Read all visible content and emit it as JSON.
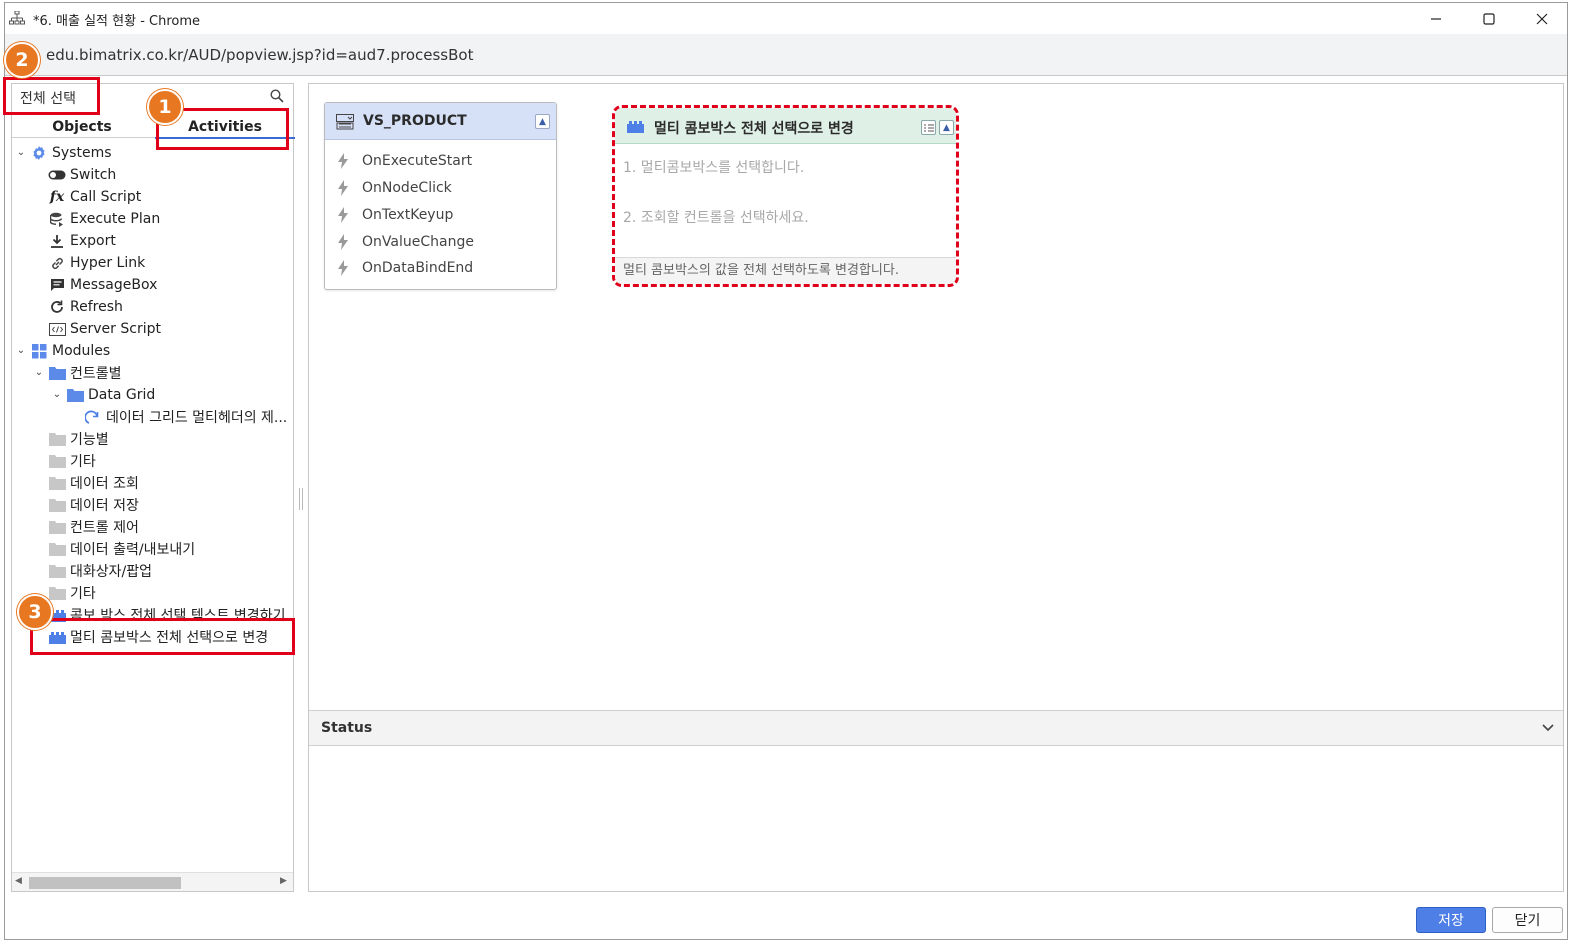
{
  "window": {
    "title": "*6. 매출 실적 현황 - Chrome",
    "url": "edu.bimatrix.co.kr/AUD/popview.jsp?id=aud7.processBot"
  },
  "left_panel": {
    "search_value": "전체 선택",
    "tabs": [
      "Objects",
      "Activities"
    ],
    "active_tab": "Activities",
    "tree": {
      "systems": {
        "label": "Systems",
        "items": [
          "Switch",
          "Call Script",
          "Execute Plan",
          "Export",
          "Hyper Link",
          "MessageBox",
          "Refresh",
          "Server Script"
        ]
      },
      "modules": {
        "label": "Modules",
        "control_folder": "컨트롤별",
        "data_grid_folder": "Data Grid",
        "data_grid_item": "데이터 그리드 멀티헤더의 제...",
        "folders": [
          "기능별",
          "기타",
          "데이터 조회",
          "데이터 저장",
          "컨트롤 제어",
          "데이터 출력/내보내기",
          "대화상자/팝업",
          "기타"
        ],
        "item_partial": "콤보 박스 전체 선택 텍스트 변경하기",
        "item_selected": "멀티 콤보박스 전체 선택으로 변경"
      }
    }
  },
  "canvas": {
    "vs_node": {
      "title": "VS_PRODUCT",
      "events": [
        "OnExecuteStart",
        "OnNodeClick",
        "OnTextKeyup",
        "OnValueChange",
        "OnDataBindEnd"
      ]
    },
    "activity_node": {
      "title": "멀티 콤보박스 전체 선택으로 변경",
      "steps": [
        "1. 멀티콤보박스를 선택합니다.",
        "2. 조회할 컨트롤을 선택하세요."
      ],
      "description": "멀티 콤보박스의 값을 전체 선택하도록 변경합니다."
    },
    "status_label": "Status"
  },
  "footer": {
    "save_label": "저장",
    "close_label": "닫기"
  },
  "annotations": {
    "badges": [
      "1",
      "2",
      "3"
    ],
    "color": "#e0001a",
    "badge_color": "#e87722"
  }
}
